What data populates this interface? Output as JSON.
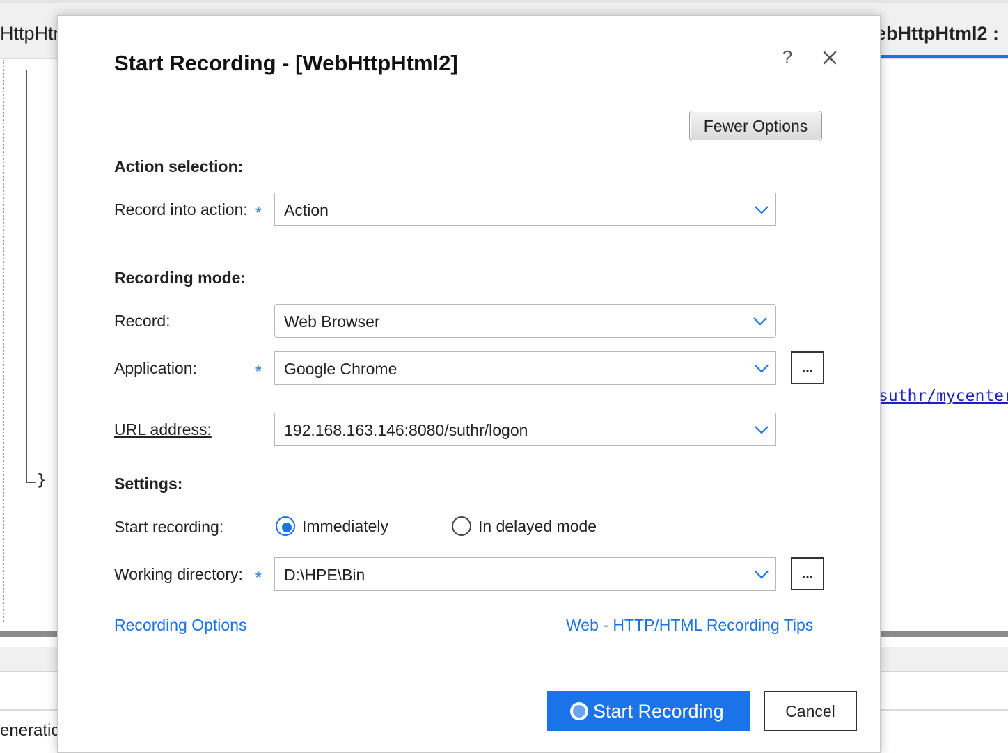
{
  "background": {
    "tab_left_text": "HttpHtr",
    "tab_right_text": "ebHttpHtml2 :",
    "code_brace": "}",
    "code_link": "suthr/mycenter",
    "bottom_text": "eneratic"
  },
  "dialog": {
    "title": "Start Recording - [WebHttpHtml2]",
    "help_glyph": "?",
    "fewer_options_label": "Fewer Options",
    "action_selection": {
      "heading": "Action selection:",
      "record_into_action_label": "Record into action:",
      "record_into_action_value": "Action"
    },
    "recording_mode": {
      "heading": "Recording mode:",
      "record_label": "Record:",
      "record_value": "Web Browser",
      "application_label": "Application:",
      "application_value": "Google Chrome",
      "url_label": "URL address:",
      "url_value": "192.168.163.146:8080/suthr/logon"
    },
    "settings": {
      "heading": "Settings:",
      "start_recording_label": "Start recording:",
      "option_immediately": "Immediately",
      "option_delayed": "In delayed mode",
      "selected_option": "Immediately",
      "working_directory_label": "Working directory:",
      "working_directory_value": "D:\\HPE\\Bin"
    },
    "required_marker": "*",
    "browse_label": "...",
    "recording_options_link": "Recording Options",
    "tips_link": "Web - HTTP/HTML Recording Tips",
    "start_button_label": "Start Recording",
    "cancel_button_label": "Cancel"
  },
  "colors": {
    "accent": "#1a73e8",
    "required": "#4a90d9",
    "dialog_bg": "#ffffff"
  }
}
